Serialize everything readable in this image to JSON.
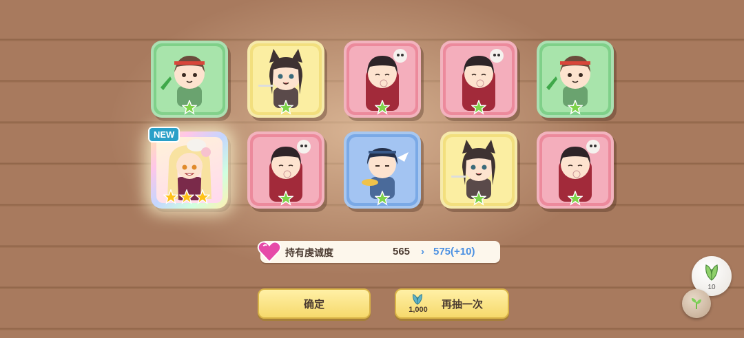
{
  "results": [
    {
      "frame": "green",
      "character": "headband-girl",
      "rarity": 1
    },
    {
      "frame": "yellow",
      "character": "wolf-ear-girl",
      "rarity": 1
    },
    {
      "frame": "pink",
      "character": "skull-hat-girl",
      "rarity": 1
    },
    {
      "frame": "pink",
      "character": "skull-hat-girl",
      "rarity": 1
    },
    {
      "frame": "green",
      "character": "headband-girl",
      "rarity": 1
    },
    {
      "frame": "rainbow",
      "character": "blonde-horn-girl",
      "rarity": 3,
      "badge": "NEW"
    },
    {
      "frame": "pink",
      "character": "skull-hat-girl",
      "rarity": 1
    },
    {
      "frame": "blue",
      "character": "bowl-girl",
      "rarity": 1
    },
    {
      "frame": "yellow",
      "character": "wolf-ear-girl",
      "rarity": 1
    },
    {
      "frame": "pink",
      "character": "skull-hat-girl",
      "rarity": 1
    }
  ],
  "faith": {
    "label": "持有虔诚度",
    "current": "565",
    "arrow": "›",
    "new_value": "575(+10)"
  },
  "buttons": {
    "confirm": "确定",
    "draw_again": "再抽一次",
    "draw_cost": "1,000"
  },
  "side": {
    "leaf_count": "10"
  },
  "colors": {
    "green": "#7fd089",
    "yellow": "#f2df7e",
    "pink": "#ec8a9c",
    "blue": "#7aa9e6",
    "star_green": "#7ed34a",
    "star_gold": "#ffc21a",
    "accent_blue": "#4a90e2"
  }
}
